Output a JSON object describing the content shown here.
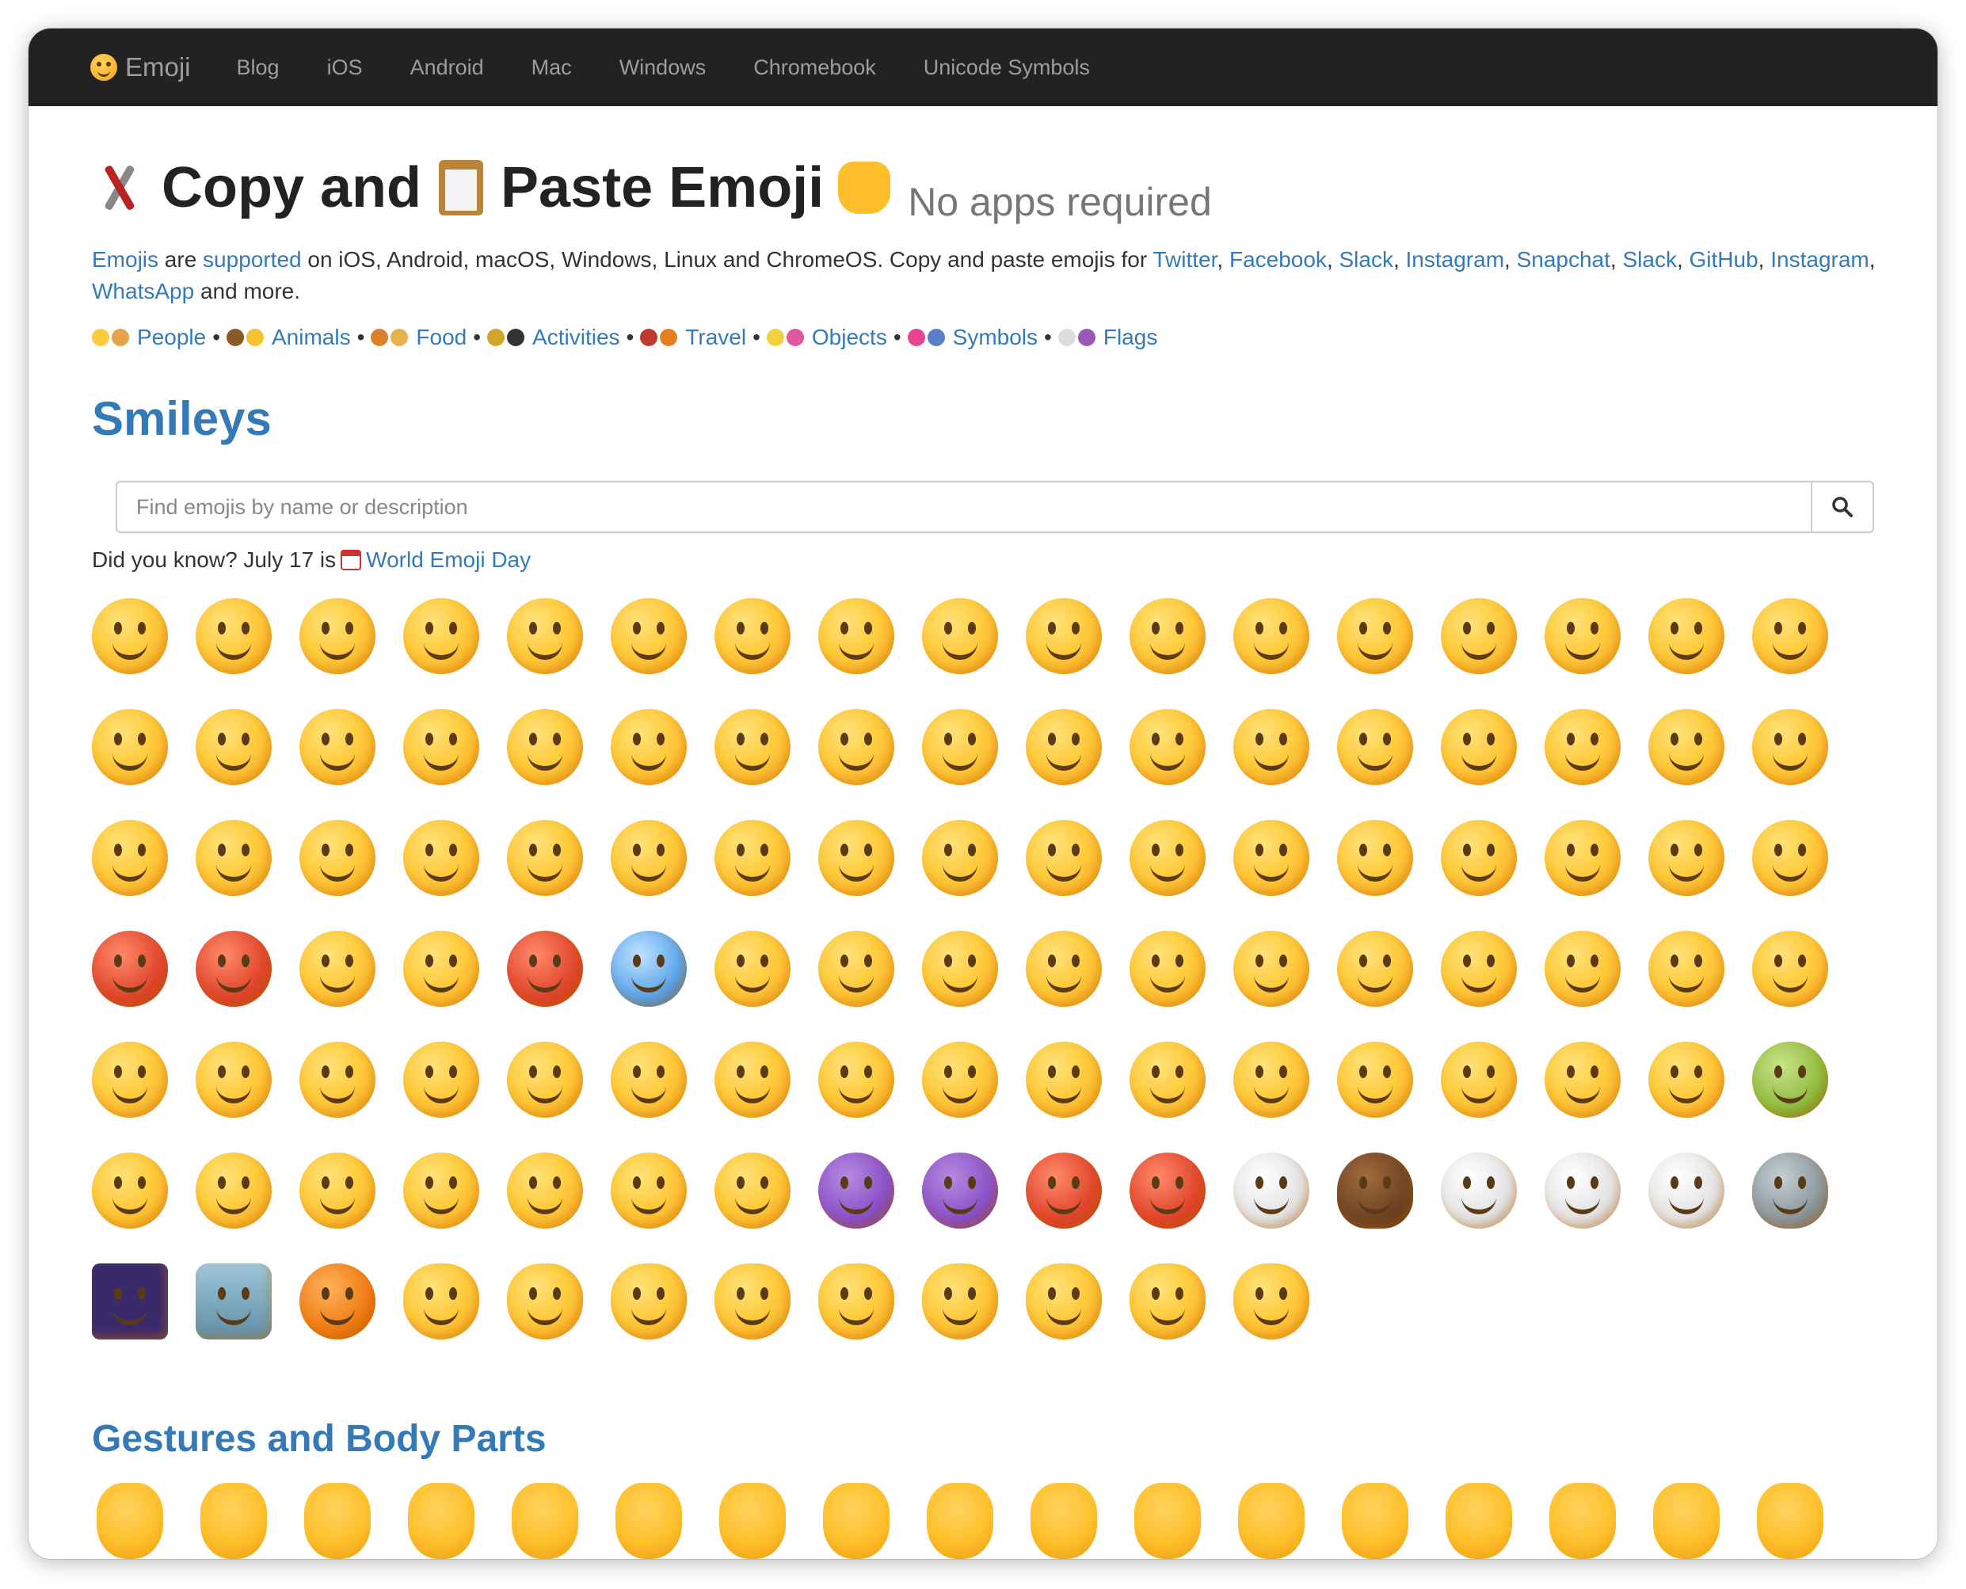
{
  "navbar": {
    "brand": "Emoji",
    "links": [
      "Blog",
      "iOS",
      "Android",
      "Mac",
      "Windows",
      "Chromebook",
      "Unicode Symbols"
    ]
  },
  "hero": {
    "title_part1": "Copy and",
    "title_part2": "Paste Emoji",
    "subtitle": "No apps required"
  },
  "intro": {
    "t1": "Emojis",
    "t2": " are ",
    "t3": "supported",
    "t4": " on iOS, Android, macOS, Windows, Linux and ChromeOS. Copy and paste emojis for ",
    "links": [
      "Twitter",
      "Facebook",
      "Slack",
      "Instagram",
      "Snapchat",
      "Slack",
      "GitHub",
      "Instagram"
    ],
    "whatsapp": "WhatsApp",
    "tail": " and more."
  },
  "categories": [
    {
      "label": "People",
      "c1": "#ffcb3d",
      "c2": "#e8a34a"
    },
    {
      "label": "Animals",
      "c1": "#8b5a2b",
      "c2": "#f2c230"
    },
    {
      "label": "Food",
      "c1": "#d9822b",
      "c2": "#e8b24a"
    },
    {
      "label": "Activities",
      "c1": "#d4a52b",
      "c2": "#333333"
    },
    {
      "label": "Travel",
      "c1": "#c0392b",
      "c2": "#e67e22"
    },
    {
      "label": "Objects",
      "c1": "#f4d03f",
      "c2": "#e056a0"
    },
    {
      "label": "Symbols",
      "c1": "#e84393",
      "c2": "#5b7fc7"
    },
    {
      "label": "Flags",
      "c1": "#dddddd",
      "c2": "#9b59b6"
    }
  ],
  "section_smileys": "Smileys",
  "search": {
    "placeholder": "Find emojis by name or description",
    "icon": "search-icon"
  },
  "didyouknow": {
    "text": "Did you know? July 17 is",
    "link": "World Emoji Day"
  },
  "smileys": [
    "grinning",
    "smiley",
    "smile",
    "grin",
    "laughing",
    "sweat-smile",
    "joy",
    "rofl",
    "face-holding-back-tears",
    "relaxed",
    "blush",
    "innocent",
    "slightly-smiling",
    "upside-down",
    "wink",
    "relieved",
    "heart-eyes",
    "smiling-hearts",
    "kissing-heart",
    "kissing",
    "kissing-smiling-eyes",
    "kissing-closed-eyes",
    "yum",
    "stuck-out-tongue",
    "stuck-out-tongue-closed-eyes",
    "stuck-out-tongue-winking",
    "zany",
    "raised-eyebrow",
    "monocle",
    "nerd",
    "sunglasses",
    "disguised",
    "star-struck",
    "partying",
    "smirk",
    "unamused",
    "disappointed",
    "pensive",
    "worried",
    "confused",
    "slightly-frowning",
    "frowning",
    "persevere",
    "confounded",
    "tired",
    "weary",
    "pleading",
    "cry",
    "sob",
    "triumph",
    "angry",
    "rage",
    "cursing",
    "exploding-head",
    "flushed",
    "hot",
    "cold",
    "scream",
    "fearful",
    "cold-sweat",
    "disappointed-relieved",
    "sweat",
    "hugging",
    "thinking",
    "hand-over-mouth",
    "shushing",
    "lying",
    "no-mouth",
    "neutral",
    "expressionless",
    "grimacing",
    "rolling-eyes",
    "hushed",
    "frowning-open-mouth",
    "anguished",
    "open-mouth",
    "astonished",
    "yawning",
    "sleeping",
    "drooling",
    "sleepy",
    "dizzy",
    "zipper-mouth",
    "woozy",
    "nauseated",
    "vomiting",
    "sneezing",
    "mask",
    "thermometer",
    "head-bandage",
    "money-mouth",
    "cowboy",
    "smiling-imp",
    "imp",
    "ogre",
    "goblin",
    "clown",
    "poop",
    "ghost",
    "skull",
    "skull-crossbones",
    "alien",
    "space-invader",
    "robot",
    "jack-o-lantern",
    "smiley-cat",
    "smile-cat",
    "joy-cat",
    "heart-eyes-cat",
    "smirk-cat",
    "kissing-cat",
    "scream-cat",
    "crying-cat",
    "pouting-cat"
  ],
  "section_gestures": "Gestures and Body Parts",
  "gestures": [
    "wave",
    "raised-back-of-hand",
    "raised-hand-fingers-splayed",
    "raised-hand",
    "vulcan-salute",
    "ok-hand",
    "pinched-fingers",
    "pinching-hand",
    "victory-hand",
    "crossed-fingers",
    "love-you-gesture",
    "sign-of-horns",
    "call-me-hand",
    "point-left",
    "point-right",
    "point-up-2",
    "middle-finger"
  ]
}
